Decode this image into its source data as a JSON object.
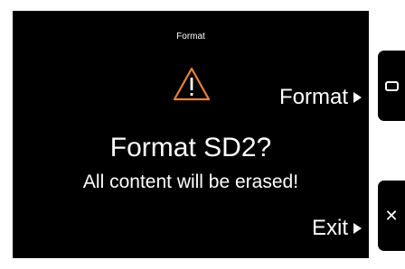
{
  "screen": {
    "title": "Format",
    "warning_icon": "warning-triangle-icon",
    "headline": "Format SD2?",
    "message": "All content will be erased!"
  },
  "softkeys": {
    "format_label": "Format",
    "exit_label": "Exit",
    "arrow_icon": "right-triangle-icon"
  },
  "hardware_buttons": {
    "top_icon": "rounded-rect-icon",
    "bottom_icon": "close-icon",
    "bottom_glyph": "✕"
  },
  "colors": {
    "background": "#000000",
    "text": "#ffffff",
    "warning": "#e8833a"
  }
}
